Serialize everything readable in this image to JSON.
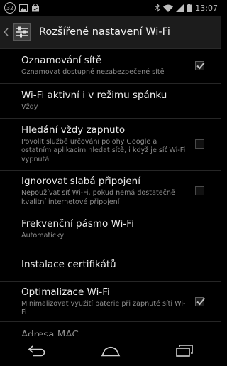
{
  "status_bar": {
    "notification_count": "32",
    "time": "13:07",
    "icons": [
      "image-icon",
      "shopping-bag-icon",
      "bluetooth-icon",
      "wifi-icon",
      "signal-icon",
      "battery-icon"
    ]
  },
  "action_bar": {
    "title": "Rozšířené nastavení Wi-Fi",
    "icon": "settings-sliders-icon"
  },
  "settings": [
    {
      "title": "Oznamování sítě",
      "subtitle": "Oznamovat dostupné nezabezpečené sítě",
      "checkbox": true,
      "checked": true
    },
    {
      "title": "Wi-Fi aktivní i v režimu spánku",
      "subtitle": "Vždy",
      "checkbox": false
    },
    {
      "title": "Hledání vždy zapnuto",
      "subtitle": "Povolit službě určování polohy Google a ostatním aplikacím hledat sítě, i když je síť Wi-Fi vypnutá",
      "checkbox": true,
      "checked": false
    },
    {
      "title": "Ignorovat slabá připojení",
      "subtitle": "Nepoužívat síť Wi-Fi, pokud nemá dostatečně kvalitní internetové připojení",
      "checkbox": true,
      "checked": false
    },
    {
      "title": "Frekvenční pásmo Wi-Fi",
      "subtitle": "Automaticky",
      "checkbox": false
    },
    {
      "title": "Instalace certifikátů",
      "subtitle": "",
      "checkbox": false
    },
    {
      "title": "Optimalizace Wi-Fi",
      "subtitle": "Minimalizovat využití baterie při zapnuté síti Wi-Fi",
      "checkbox": true,
      "checked": true
    },
    {
      "title": "Adresa MAC",
      "subtitle": "",
      "checkbox": false
    }
  ],
  "nav_bar": {
    "buttons": [
      "back-icon",
      "home-icon",
      "recent-apps-icon"
    ]
  }
}
